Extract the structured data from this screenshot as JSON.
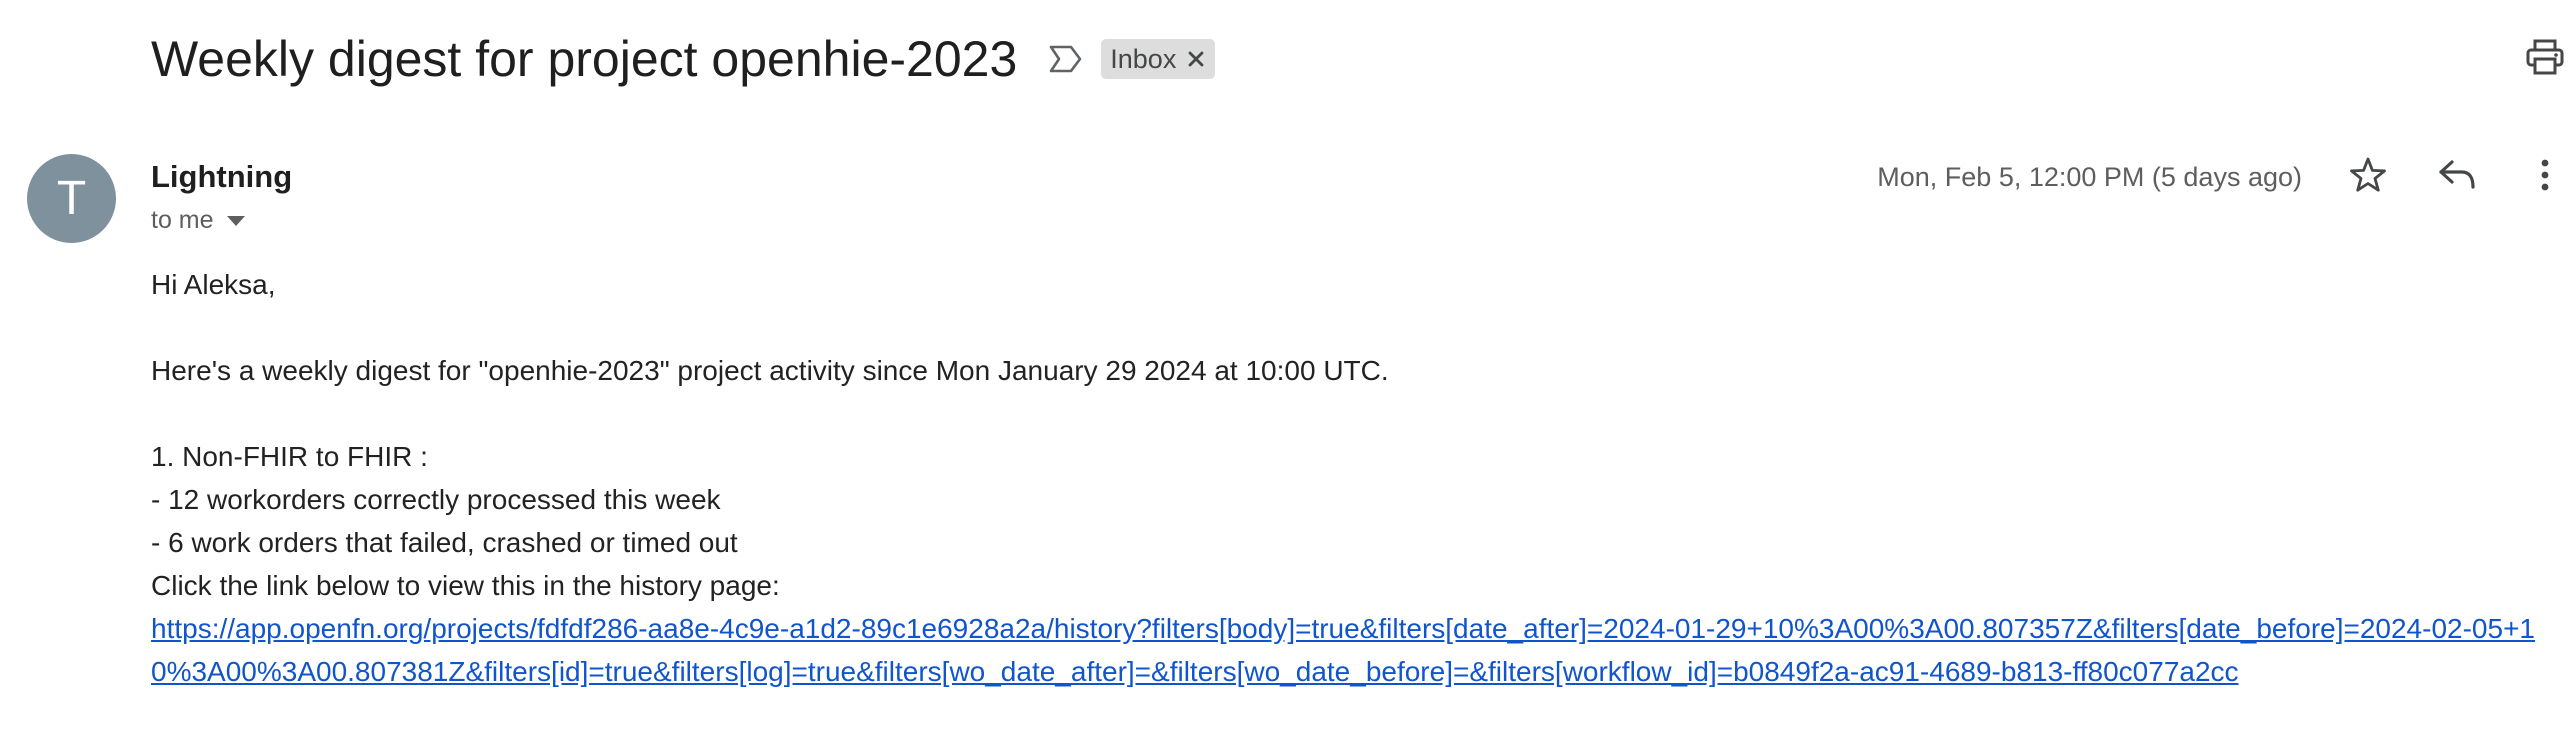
{
  "email": {
    "subject": "Weekly digest for project openhie-2023",
    "label": "Inbox",
    "sender": {
      "initial": "T",
      "name": "Lightning"
    },
    "recipient": "to me",
    "timestamp": "Mon, Feb 5, 12:00 PM (5 days ago)",
    "body": {
      "greeting": "Hi Aleksa,",
      "intro": "Here's a weekly digest for \"openhie-2023\" project activity since Mon January 29 2024 at 10:00 UTC.",
      "section_title": "1. Non-FHIR to FHIR :",
      "line_processed": "- 12 workorders correctly processed this week",
      "line_failed": "- 6 work orders that failed, crashed or timed out",
      "link_prompt": "Click the link below to view this in the history page:",
      "history_link": "https://app.openfn.org/projects/fdfdf286-aa8e-4c9e-a1d2-89c1e6928a2a/history?filters[body]=true&filters[date_after]=2024-01-29+10%3A00%3A00.807357Z&filters[date_before]=2024-02-05+10%3A00%3A00.807381Z&filters[id]=true&filters[log]=true&filters[wo_date_after]=&filters[wo_date_before]=&filters[workflow_id]=b0849f2a-ac91-4689-b813-ff80c077a2cc"
    }
  },
  "icons": {
    "important": "important-marker-icon",
    "label_remove": "close-icon",
    "print": "print-icon",
    "recipient_details": "chevron-down-icon",
    "star": "star-icon",
    "reply": "reply-icon",
    "more": "more-vertical-icon"
  },
  "colors": {
    "avatar": "#7e919d",
    "label_chip": "#dddddd",
    "link": "#1155cc",
    "icon": "#444746"
  }
}
